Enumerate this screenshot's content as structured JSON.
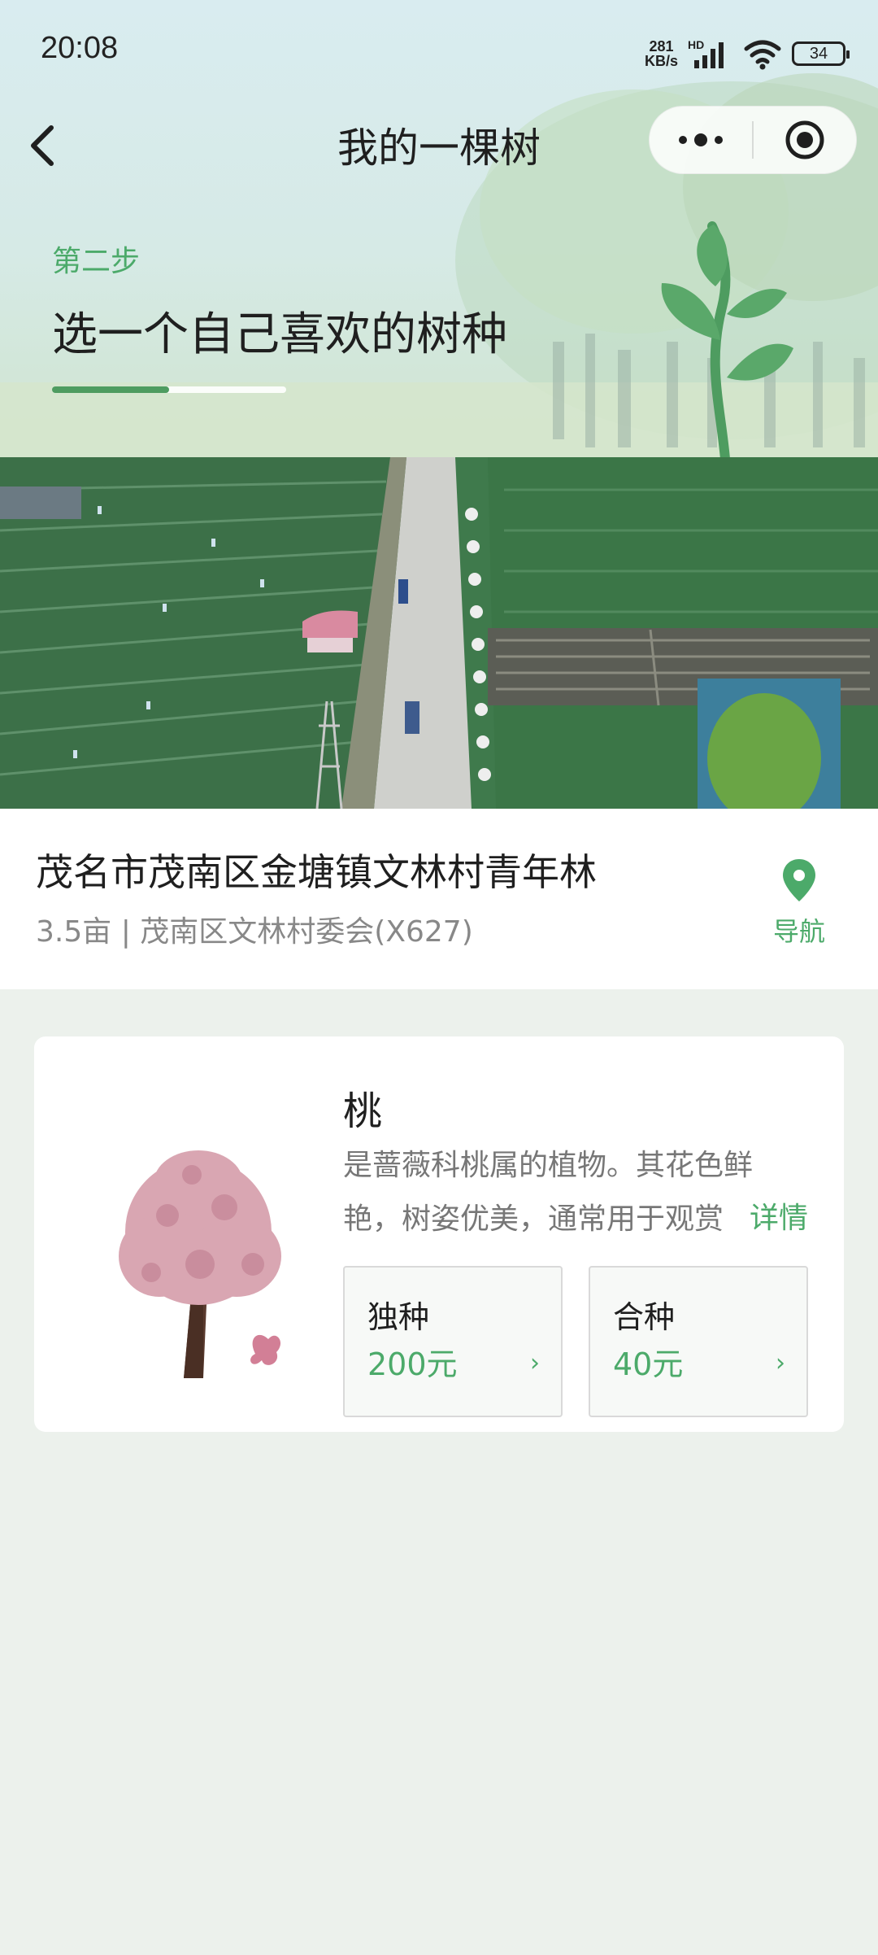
{
  "status_bar": {
    "time": "20:08",
    "net_speed_value": "281",
    "net_speed_unit": "KB/s",
    "network_tag": "HD",
    "battery": "34"
  },
  "nav": {
    "title": "我的一棵树"
  },
  "step": {
    "label": "第二步",
    "title": "选一个自己喜欢的树种",
    "progress": 0.5
  },
  "location": {
    "name": "茂名市茂南区金塘镇文林村青年林",
    "meta": "3.5亩 | 茂南区文林村委会(X627)",
    "nav_label": "导航"
  },
  "tree": {
    "name": "桃",
    "description": "是蔷薇科桃属的植物。其花色鲜艳，树姿优美，通常用于观赏",
    "more_label": "详情",
    "options": [
      {
        "label": "独种",
        "price": "200元"
      },
      {
        "label": "合种",
        "price": "40元"
      }
    ]
  },
  "colors": {
    "accent_green": "#4caa6a",
    "page_bg": "#ecf1ec"
  }
}
